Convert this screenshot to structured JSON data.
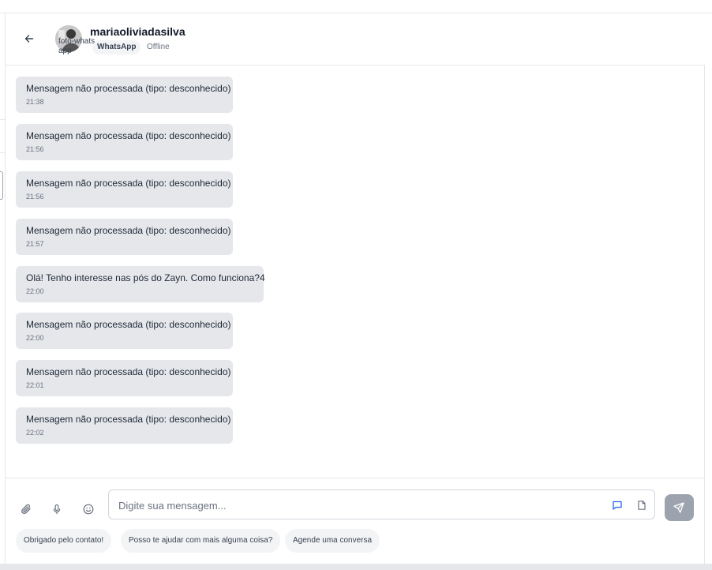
{
  "header": {
    "contact_name": "mariaoliviadasilva",
    "avatar_alt": "foto-whatsapp",
    "channel": "WhatsApp",
    "status": "Offline"
  },
  "messages": [
    {
      "text": "Mensagem não processada (tipo: desconhecido)",
      "time": "21:38"
    },
    {
      "text": "Mensagem não processada (tipo: desconhecido)",
      "time": "21:56"
    },
    {
      "text": "Mensagem não processada (tipo: desconhecido)",
      "time": "21:56"
    },
    {
      "text": "Mensagem não processada (tipo: desconhecido)",
      "time": "21:57"
    },
    {
      "text": "Olá! Tenho interesse nas pós do Zayn. Como funciona?4",
      "time": "22:00"
    },
    {
      "text": "Mensagem não processada (tipo: desconhecido)",
      "time": "22:00"
    },
    {
      "text": "Mensagem não processada (tipo: desconhecido)",
      "time": "22:01"
    },
    {
      "text": "Mensagem não processada (tipo: desconhecido)",
      "time": "22:02"
    }
  ],
  "composer": {
    "placeholder": "Digite sua mensagem...",
    "quick_replies": [
      "Obrigado pelo contato!",
      "Posso te ajudar com mais alguma coisa?",
      "Agende uma conversa"
    ]
  },
  "icons": {
    "back": "arrow-left-icon",
    "attach": "paperclip-icon",
    "mic": "microphone-icon",
    "emoji": "smiley-icon",
    "quick_reply": "message-square-icon",
    "template": "file-icon",
    "send": "send-icon"
  },
  "colors": {
    "bubble": "#e5e7eb",
    "quick_reply_icon": "#2563eb",
    "send_button": "#9ca3af"
  }
}
